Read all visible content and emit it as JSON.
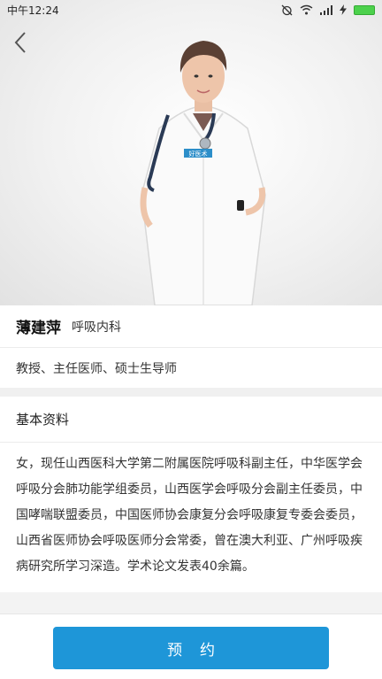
{
  "status_bar": {
    "time": "中午12:24"
  },
  "header": {
    "back_icon": "chevron-left-icon"
  },
  "doctor": {
    "name": "薄建萍",
    "department": "呼吸内科",
    "titles": "教授、主任医师、硕士生导师",
    "badge_text": "好医术"
  },
  "profile": {
    "heading": "基本资料",
    "bio": "女，现任山西医科大学第二附属医院呼吸科副主任，中华医学会呼吸分会肺功能学组委员，山西医学会呼吸分会副主任委员，中国哮喘联盟委员，中国医师协会康复分会呼吸康复专委会委员，山西省医师协会呼吸医师分会常委，曾在澳大利亚、广州呼吸疾病研究所学习深造。学术论文发表40余篇。"
  },
  "actions": {
    "book_label": "预约"
  },
  "colors": {
    "accent": "#1e96d8",
    "battery": "#4cd14c"
  }
}
